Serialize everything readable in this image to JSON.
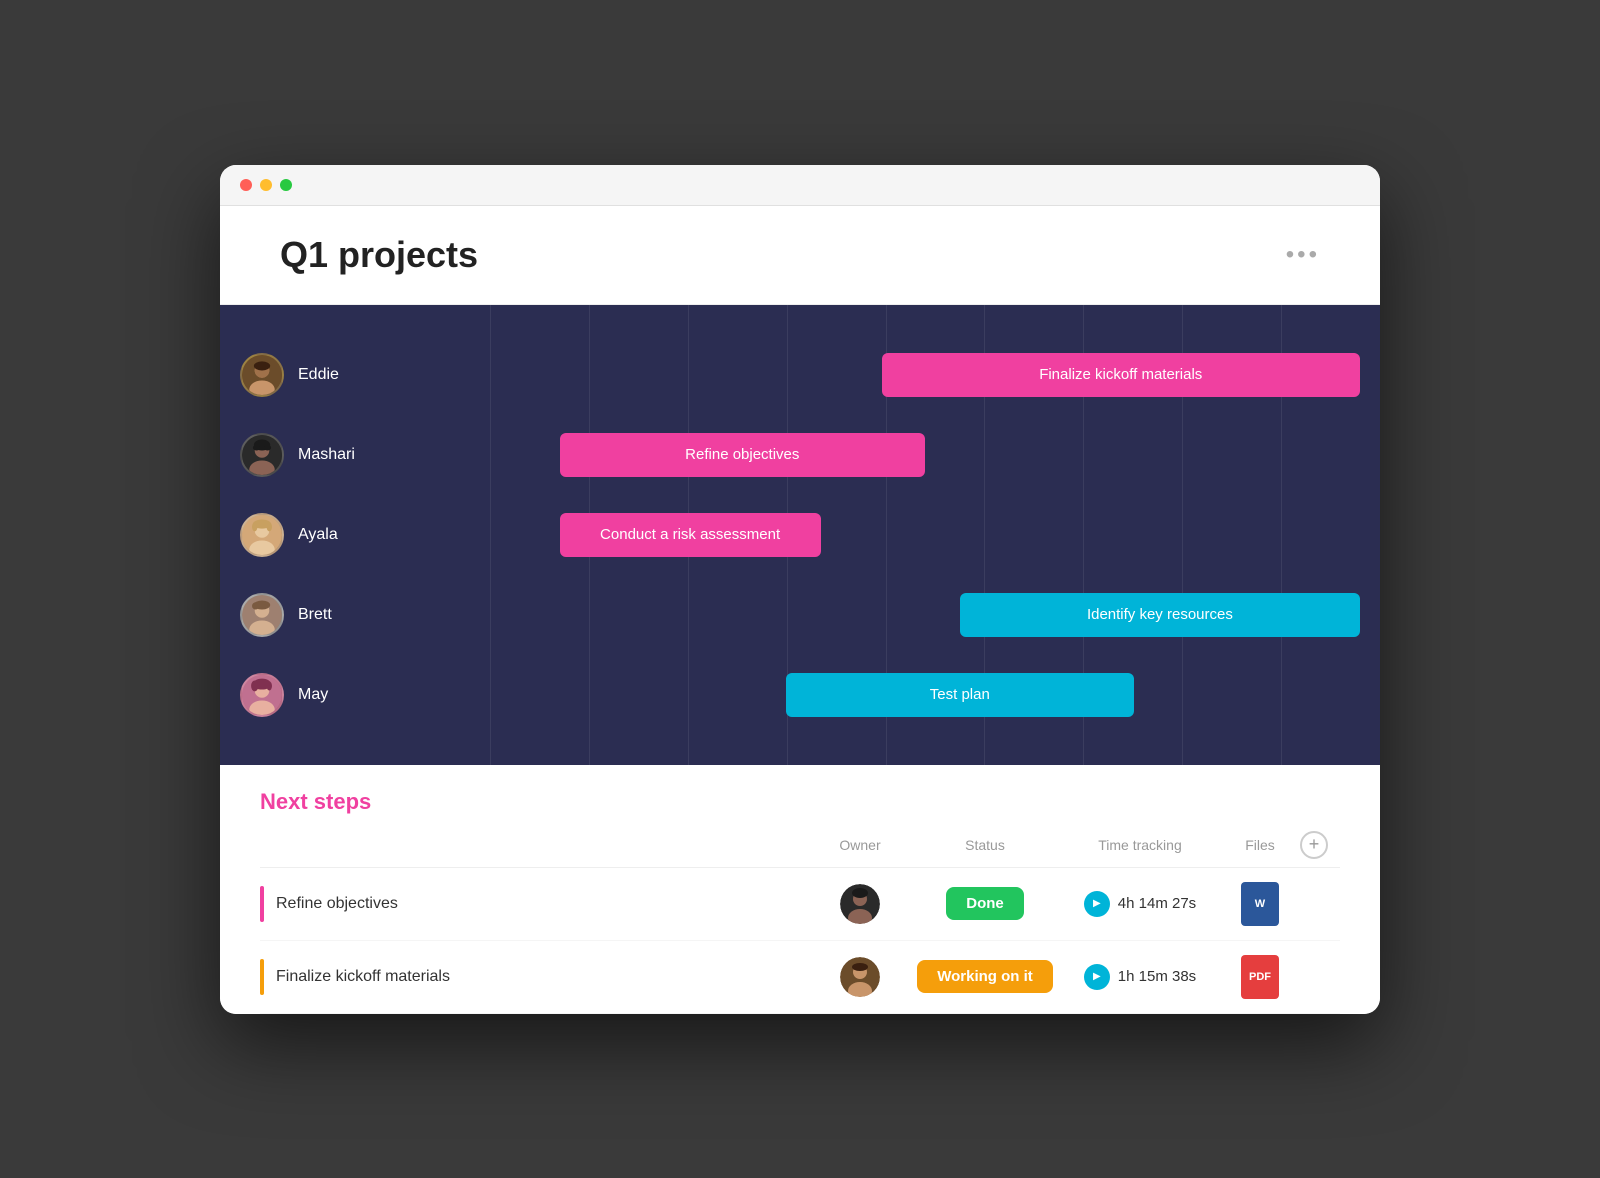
{
  "window": {
    "title": "Q1 projects",
    "more_label": "•••"
  },
  "header": {
    "title": "Q1 projects",
    "more_icon": "•••"
  },
  "gantt": {
    "people": [
      {
        "name": "Eddie",
        "avatar_key": "eddie",
        "bar_label": "Finalize kickoff materials",
        "bar_color": "pink",
        "bar_class": "bar-eddie"
      },
      {
        "name": "Mashari",
        "avatar_key": "mashari",
        "bar_label": "Refine objectives",
        "bar_color": "pink",
        "bar_class": "bar-mashari"
      },
      {
        "name": "Ayala",
        "avatar_key": "ayala",
        "bar_label": "Conduct a risk assessment",
        "bar_color": "pink",
        "bar_class": "bar-ayala"
      },
      {
        "name": "Brett",
        "avatar_key": "brett",
        "bar_label": "Identify key resources",
        "bar_color": "cyan",
        "bar_class": "bar-brett"
      },
      {
        "name": "May",
        "avatar_key": "may",
        "bar_label": "Test plan",
        "bar_color": "cyan",
        "bar_class": "bar-may"
      }
    ]
  },
  "next_steps": {
    "heading": "Next steps",
    "columns": {
      "owner": "Owner",
      "status": "Status",
      "time_tracking": "Time tracking",
      "files": "Files"
    },
    "tasks": [
      {
        "name": "Refine objectives",
        "bar_color": "#f040a0",
        "owner_key": "mashari",
        "status": "Done",
        "status_type": "done",
        "time": "4h 14m 27s",
        "file_type": "word",
        "file_label": "W"
      },
      {
        "name": "Finalize kickoff materials",
        "bar_color": "#f59e0b",
        "owner_key": "eddie",
        "status": "Working on it",
        "status_type": "working",
        "time": "1h 15m 38s",
        "file_type": "pdf",
        "file_label": "PDF"
      }
    ]
  }
}
